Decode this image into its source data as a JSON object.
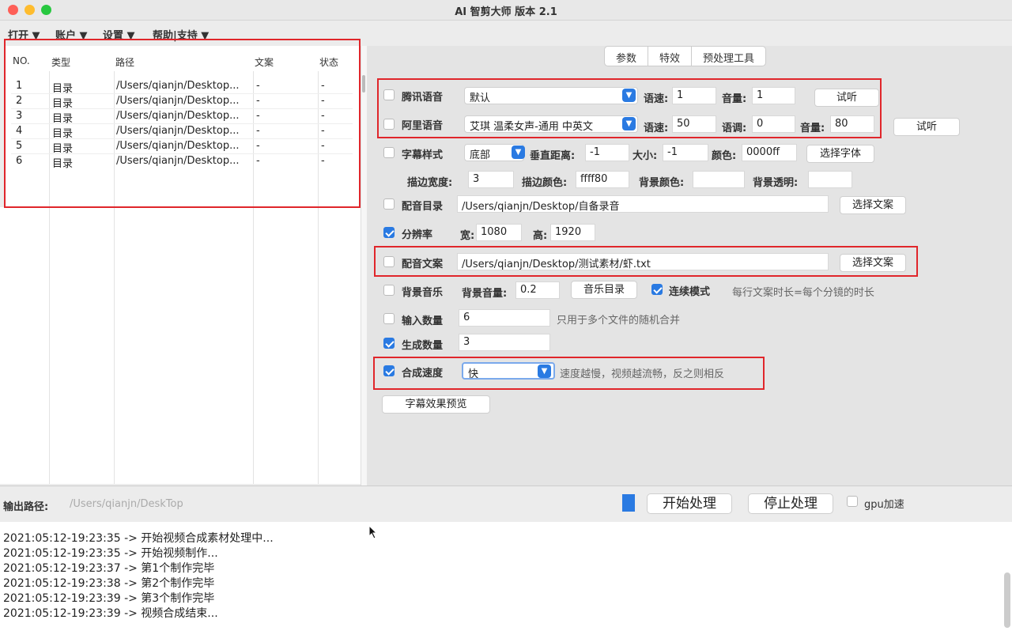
{
  "window": {
    "title": "AI 智剪大师 版本 2.1",
    "traffic_lights": [
      "#fe5f57",
      "#febc2e",
      "#28c840"
    ]
  },
  "menu": [
    "打开 ▼",
    "账户 ▼",
    "设置 ▼",
    "帮助|支持 ▼"
  ],
  "table": {
    "headers": [
      "NO.",
      "类型",
      "路径",
      "文案",
      "状态"
    ],
    "rows": [
      {
        "no": "1",
        "type": "目录",
        "path": "/Users/qianjn/Desktop...",
        "copy": "-",
        "status": "-"
      },
      {
        "no": "2",
        "type": "目录",
        "path": "/Users/qianjn/Desktop...",
        "copy": "-",
        "status": "-"
      },
      {
        "no": "3",
        "type": "目录",
        "path": "/Users/qianjn/Desktop...",
        "copy": "-",
        "status": "-"
      },
      {
        "no": "4",
        "type": "目录",
        "path": "/Users/qianjn/Desktop...",
        "copy": "-",
        "status": "-"
      },
      {
        "no": "5",
        "type": "目录",
        "path": "/Users/qianjn/Desktop...",
        "copy": "-",
        "status": "-"
      },
      {
        "no": "6",
        "type": "目录",
        "path": "/Users/qianjn/Desktop...",
        "copy": "-",
        "status": "-"
      }
    ]
  },
  "tabs": [
    "参数",
    "特效",
    "预处理工具"
  ],
  "settings": {
    "tencent": {
      "label": "腾讯语音",
      "voice": "默认",
      "speed_label": "语速:",
      "speed": "1",
      "volume_label": "音量:",
      "volume": "1",
      "listen": "试听"
    },
    "aliyun": {
      "label": "阿里语音",
      "voice": "艾琪 温柔女声-通用 中英文",
      "speed_label": "语速:",
      "speed": "50",
      "pitch_label": "语调:",
      "pitch": "0",
      "volume_label": "音量:",
      "volume": "80",
      "listen": "试听"
    },
    "subtitle": {
      "label": "字幕样式",
      "position": "底部",
      "vmargin_label": "垂直距离:",
      "vmargin": "-1",
      "size_label": "大小:",
      "size": "-1",
      "color_label": "颜色:",
      "color": "0000ff",
      "font_button": "选择字体"
    },
    "stroke": {
      "width_label": "描边宽度:",
      "width": "3",
      "color_label": "描边颜色:",
      "color": "ffff80",
      "bg_color_label": "背景颜色:",
      "bg_color": "",
      "bg_alpha_label": "背景透明:",
      "bg_alpha": ""
    },
    "dub_dir": {
      "label": "配音目录",
      "path": "/Users/qianjn/Desktop/自备录音",
      "button": "选择文案"
    },
    "resolution": {
      "label": "分辨率",
      "width_label": "宽:",
      "width": "1080",
      "height_label": "高:",
      "height": "1920"
    },
    "dub_copy": {
      "label": "配音文案",
      "path": "/Users/qianjn/Desktop/测试素材/虾.txt",
      "button": "选择文案"
    },
    "bgm": {
      "label": "背景音乐",
      "volume_label": "背景音量:",
      "volume": "0.2",
      "dir_button": "音乐目录",
      "continuous_label": "连续模式",
      "hint": "每行文案时长=每个分镜的时长"
    },
    "input_count": {
      "label": "输入数量",
      "value": "6",
      "hint": "只用于多个文件的随机合并"
    },
    "output_count": {
      "label": "生成数量",
      "value": "3"
    },
    "speed": {
      "label": "合成速度",
      "value": "快",
      "hint": "速度越慢，视频越流畅，反之则相反"
    },
    "preview_button": "字幕效果预览"
  },
  "bottom": {
    "output_label": "输出路径:",
    "output_placeholder": "/Users/qianjn/DeskTop",
    "start": "开始处理",
    "stop": "停止处理",
    "gpu": "gpu加速"
  },
  "log": [
    "2021:05:12-19:23:35 -> 开始视频合成素材处理中...",
    "2021:05:12-19:23:35 -> 开始视频制作...",
    "2021:05:12-19:23:37 -> 第1个制作完毕",
    "2021:05:12-19:23:38 -> 第2个制作完毕",
    "2021:05:12-19:23:39 -> 第3个制作完毕",
    "2021:05:12-19:23:39 -> 视频合成结束..."
  ],
  "colors": {
    "accent": "#2a7ae2",
    "highlight_box": "#e0262b"
  }
}
